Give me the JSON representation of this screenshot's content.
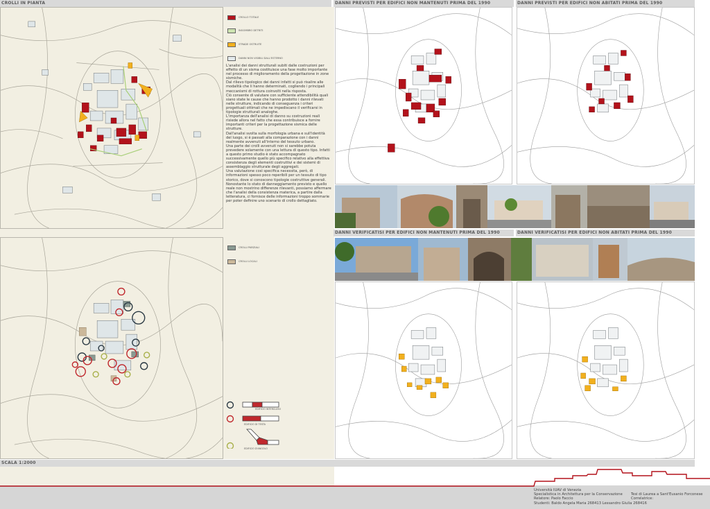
{
  "sections": {
    "top_left_title": "CROLLI IN PIANTA",
    "top_mid_title": "DANNI PREVISTI PER EDIFICI NON MANTENUTI PRIMA DEL 1990",
    "top_right_title": "DANNI PREVISTI PER EDIFICI NON ABITATI PRIMA DEL 1990",
    "mid_mid_title": "DANNI VERIFICATISI PER EDIFICI NON MANTENUTI PRIMA DEL 1990",
    "mid_right_title": "DANNI VERIFICATISI PER EDIFICI NON ABITATI PRIMA DEL 1990",
    "scale_label": "SCALA 1:2000"
  },
  "legend_top": [
    {
      "label": "CROLLO TOTALE",
      "color": "#b3121b"
    },
    {
      "label": "INGOMBRO DETRITI",
      "color": "#cde3b0"
    },
    {
      "label": "STRADE OSTRUITE",
      "color": "#f2b01e"
    },
    {
      "label": "DANNI NON VISIBILI DALL'ESTERNO",
      "color": "#e4eaec"
    }
  ],
  "legend_bottom": [
    {
      "label": "CROLLI PARZIALI",
      "color": "#8a9a92"
    },
    {
      "label": "CROLLI LOCALI",
      "color": "#cbb89a"
    }
  ],
  "legend_symbols": [
    {
      "label": "EDIFICIO INTERCLUSO",
      "ring_color": "#2b3a44"
    },
    {
      "label": "EDIFICIO DI TESTA",
      "ring_color": "#c0282d"
    },
    {
      "label": "EDIFICIO D'ANGOLO",
      "ring_color": "#a8b04a"
    }
  ],
  "body_text": [
    "L'analisi dei danni strutturali subiti dalle costruzioni per effetto di un sisma costituisce una fase molto importante nel processo di miglioramento della progettazione in zone sismiche.",
    "Dal rilievo tipologico dei danni infatti si può risalire alle modalità che li hanno determinati, cogliendo i principali meccanismi di rottura coinvolti nella risposta.",
    "Ciò consente di valutare con sufficiente attendibilità quali siano state le cause che hanno prodotto i danni rilevati nelle strutture, indicando di conseguenza i criteri progettuali ottimali che ne impediscano il verificarsi in tipologie strutturali analoghe.",
    "L'importanza dell'analisi di danno su costruzioni reali risiede allora nel fatto che essa contribuisce a fornire importanti criteri per la progettazione sismica delle strutture.",
    "Dall'analisi svolta sulla morfologia urbana e sull'identità del luogo, si è passati alla comparazione con i danni realmente avvenuti all'interno del tessuto urbano.",
    "Una parte dei crolli avvenuti non si sarebbe potuta prevedere solamente con una lettura di questo tipo. Infatti a questo primo studio è stato accompagnato successivamente quello più specifico relativo alla effettiva consistenza degli elementi costruttivi e dei sistemi di assemblaggio strutturale degli aggregati.",
    "Una valutazione così specifica necessita, però, di informazioni spesso poco reperibili per un tessuto di tipo storico, dove si conoscono tipologie costruttive generali.",
    "Nonostante lo stato di danneggiamento previsto e quello reale non mostrino differenze rilevanti, possiamo affermare che l'analisi della consistenza materica, a partire dalla letteratura, ci fornisce delle informazioni troppo sommarie per poter definire uno scenario di crollo dettagliato."
  ],
  "credits": {
    "university": "Università IUAV di Venezia",
    "course": "Specialistica in Architettura per la Conservazione",
    "advisor": "Relatore: Paolo Faccio",
    "students": "Studenti: Baldo Angela Maria 268413     Lessandro Giulia 268416",
    "thesis": "Tesi di Laurea a Sant'Eusanio Forconese",
    "coadvisor": "Correlatrice:"
  },
  "colors": {
    "collapse_red": "#b3121b",
    "debris_green": "#cde3b0",
    "road_orange": "#f2b01e",
    "invisible_gray": "#e4eaec",
    "footer_line": "#b3121b"
  }
}
